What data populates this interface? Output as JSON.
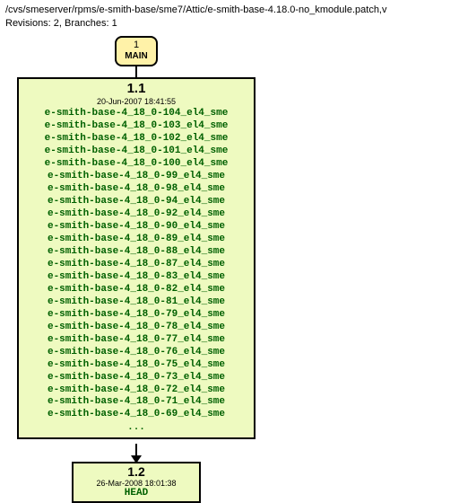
{
  "header": {
    "path": "/cvs/smeserver/rpms/e-smith-base/sme7/Attic/e-smith-base-4.18.0-no_kmodule.patch,v",
    "meta": "Revisions: 2, Branches: 1"
  },
  "branch": {
    "num": "1",
    "name": "MAIN"
  },
  "rev1": {
    "title": "1.1",
    "date": "20-Jun-2007 18:41:55",
    "tags": [
      "e-smith-base-4_18_0-104_el4_sme",
      "e-smith-base-4_18_0-103_el4_sme",
      "e-smith-base-4_18_0-102_el4_sme",
      "e-smith-base-4_18_0-101_el4_sme",
      "e-smith-base-4_18_0-100_el4_sme",
      "e-smith-base-4_18_0-99_el4_sme",
      "e-smith-base-4_18_0-98_el4_sme",
      "e-smith-base-4_18_0-94_el4_sme",
      "e-smith-base-4_18_0-92_el4_sme",
      "e-smith-base-4_18_0-90_el4_sme",
      "e-smith-base-4_18_0-89_el4_sme",
      "e-smith-base-4_18_0-88_el4_sme",
      "e-smith-base-4_18_0-87_el4_sme",
      "e-smith-base-4_18_0-83_el4_sme",
      "e-smith-base-4_18_0-82_el4_sme",
      "e-smith-base-4_18_0-81_el4_sme",
      "e-smith-base-4_18_0-79_el4_sme",
      "e-smith-base-4_18_0-78_el4_sme",
      "e-smith-base-4_18_0-77_el4_sme",
      "e-smith-base-4_18_0-76_el4_sme",
      "e-smith-base-4_18_0-75_el4_sme",
      "e-smith-base-4_18_0-73_el4_sme",
      "e-smith-base-4_18_0-72_el4_sme",
      "e-smith-base-4_18_0-71_el4_sme",
      "e-smith-base-4_18_0-69_el4_sme"
    ],
    "ellipsis": "..."
  },
  "rev2": {
    "title": "1.2",
    "date": "26-Mar-2008 18:01:38",
    "head": "HEAD"
  }
}
